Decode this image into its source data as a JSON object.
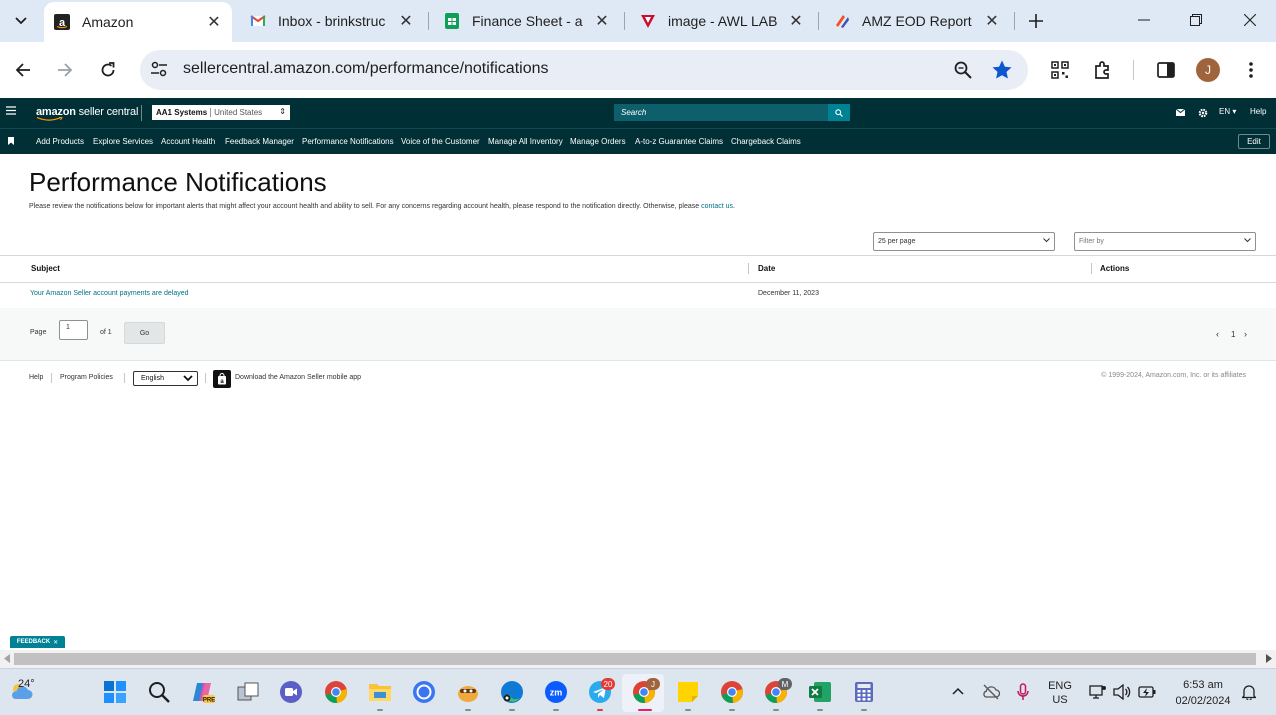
{
  "browser": {
    "tabs": [
      {
        "title": "Amazon",
        "icon": "amazon-icon",
        "active": true
      },
      {
        "title": "Inbox - brinkstruc",
        "icon": "gmail-icon",
        "active": false
      },
      {
        "title": "Finance Sheet - a",
        "icon": "sheets-icon",
        "active": false
      },
      {
        "title": "image - AWL LAB",
        "icon": "awl-icon",
        "active": false
      },
      {
        "title": "AMZ EOD Report",
        "icon": "report-icon",
        "active": false
      }
    ],
    "url": "sellercentral.amazon.com/performance/notifications",
    "profile_initial": "J"
  },
  "seller_central": {
    "logo_bold": "amazon",
    "logo_light": "seller central",
    "account_name": "AA1 Systems",
    "account_region": "United States",
    "search_placeholder": "Search",
    "lang": "EN",
    "help": "Help",
    "nav": [
      "Add Products",
      "Explore Services",
      "Account Health",
      "Feedback Manager",
      "Performance Notifications",
      "Voice of the Customer",
      "Manage All Inventory",
      "Manage Orders",
      "A-to-z Guarantee Claims",
      "Chargeback Claims"
    ],
    "edit": "Edit"
  },
  "page": {
    "title": "Performance Notifications",
    "description": "Please review the notifications below for important alerts that might affect your account health and ability to sell. For any concerns regarding account health, please respond to the notification directly. Otherwise, please ",
    "contact_link": "contact us",
    "description_end": ".",
    "per_page": "25 per page",
    "filter_placeholder": "Filter by",
    "columns": {
      "subject": "Subject",
      "date": "Date",
      "actions": "Actions"
    },
    "rows": [
      {
        "subject": "Your Amazon Seller account payments are delayed",
        "date": "December 11, 2023"
      }
    ],
    "pager": {
      "page_label": "Page",
      "page_value": "1",
      "of_label": "of 1",
      "go": "Go",
      "current": "1"
    }
  },
  "footer": {
    "help": "Help",
    "policies": "Program Policies",
    "language": "English",
    "app_link": "Download the Amazon Seller mobile app",
    "copyright": "© 1999-2024, Amazon.com, Inc. or its affiliates"
  },
  "feedback": "FEEDBACK",
  "taskbar": {
    "temperature": "24°",
    "telegram_badge": "20",
    "chrome_profile_j": "J",
    "chrome_profile_m": "M",
    "lang_line1": "ENG",
    "lang_line2": "US",
    "time": "6:53 am",
    "date": "02/02/2024"
  }
}
